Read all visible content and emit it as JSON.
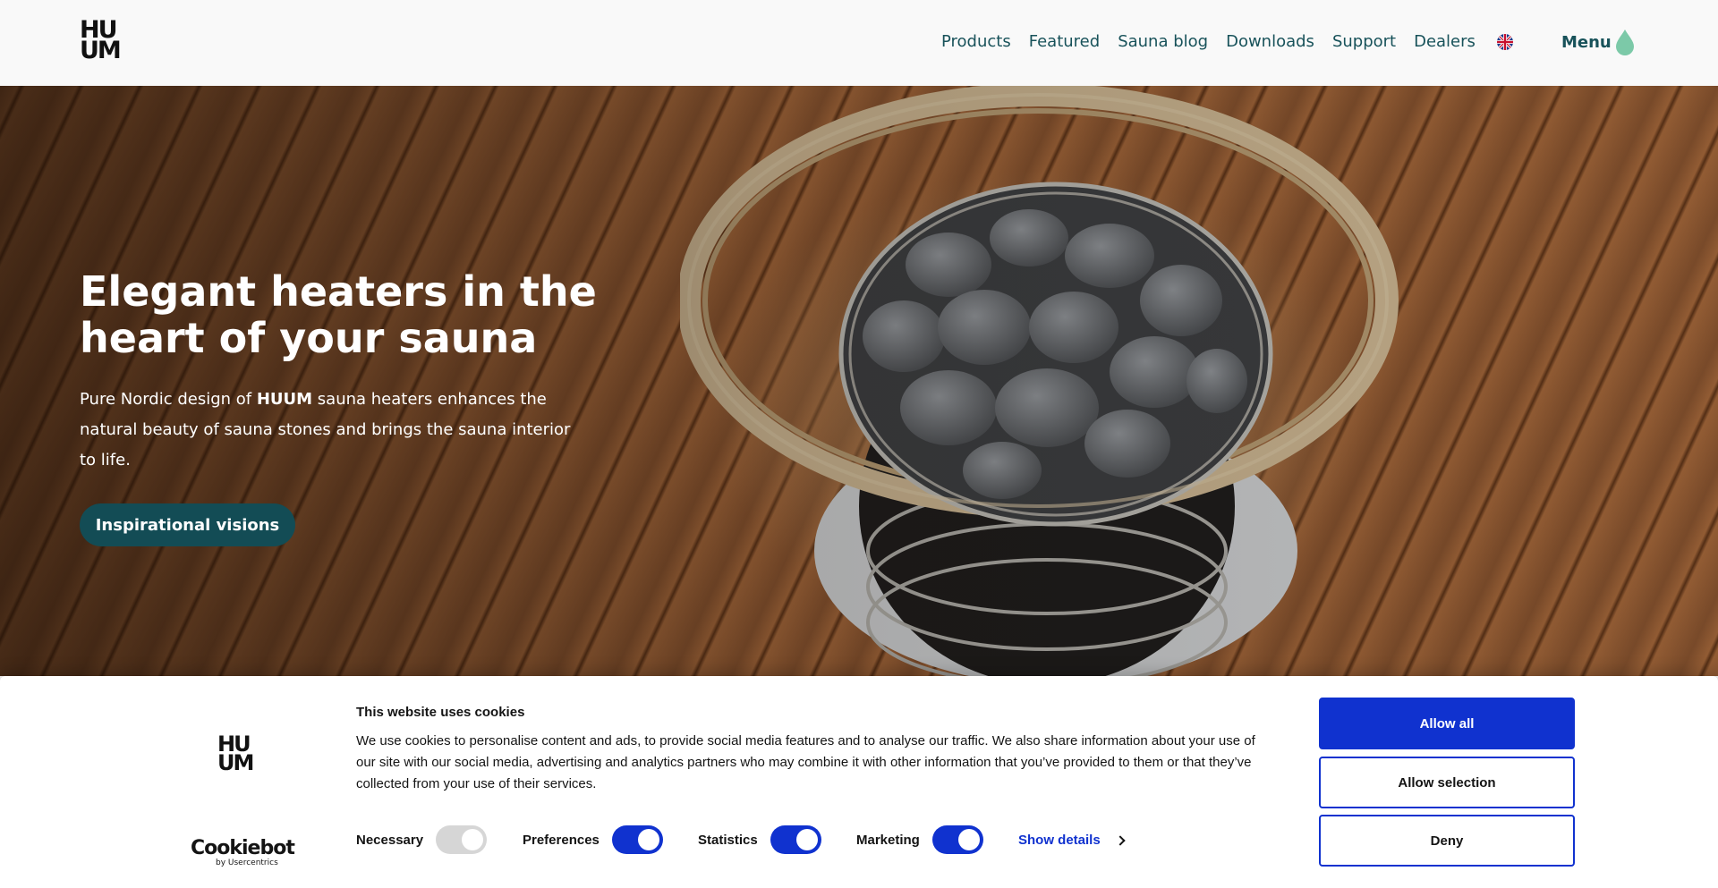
{
  "header": {
    "logo_line1": "HU",
    "logo_line2": "UM",
    "nav": [
      "Products",
      "Featured",
      "Sauna blog",
      "Downloads",
      "Support",
      "Dealers"
    ],
    "language_icon": "uk-flag-icon",
    "menu_label": "Menu",
    "menu_icon": "water-drop-icon",
    "accent_color": "#18525a",
    "drop_color": "#7cc9a8"
  },
  "hero": {
    "title": "Elegant heaters in the heart of your sauna",
    "text_before": "Pure Nordic design of ",
    "text_brand": "HUUM",
    "text_after": " sauna heaters enhances the natural beauty of sauna stones and brings the sauna interior to life.",
    "button_label": "Inspirational visions",
    "button_color": "#134c55"
  },
  "cookie": {
    "logo_line1": "HU",
    "logo_line2": "UM",
    "cookiebot_word": "Cookiebot",
    "cookiebot_sub": "by Usercentrics",
    "title": "This website uses cookies",
    "body": "We use cookies to personalise content and ads, to provide social media features and to analyse our traffic. We also share information about your use of our site with our social media, advertising and analytics partners who may combine it with other information that you’ve provided to them or that they’ve collected from your use of their services.",
    "toggles": [
      {
        "label": "Necessary",
        "on": true,
        "disabled": true
      },
      {
        "label": "Preferences",
        "on": true,
        "disabled": false
      },
      {
        "label": "Statistics",
        "on": true,
        "disabled": false
      },
      {
        "label": "Marketing",
        "on": true,
        "disabled": false
      }
    ],
    "show_details": "Show details",
    "allow_all": "Allow all",
    "allow_selection": "Allow selection",
    "deny": "Deny",
    "accent_color": "#1032cf"
  }
}
